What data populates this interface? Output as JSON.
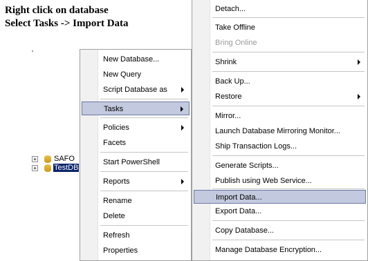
{
  "instructions": {
    "line1": "Right click on database",
    "line2": "Select Tasks -> Import Data"
  },
  "tree": {
    "nodes": [
      {
        "label": "SAFO",
        "selected": false
      },
      {
        "label": "TestDB",
        "selected": true
      }
    ]
  },
  "context_menu": {
    "items": [
      {
        "label": "New Database...",
        "submenu": false
      },
      {
        "label": "New Query",
        "submenu": false
      },
      {
        "label": "Script Database as",
        "submenu": true
      },
      {
        "label": "Tasks",
        "submenu": true,
        "highlighted": true
      },
      {
        "label": "Policies",
        "submenu": true
      },
      {
        "label": "Facets",
        "submenu": false
      },
      {
        "label": "Start PowerShell",
        "submenu": false
      },
      {
        "label": "Reports",
        "submenu": true
      },
      {
        "label": "Rename",
        "submenu": false
      },
      {
        "label": "Delete",
        "submenu": false
      },
      {
        "label": "Refresh",
        "submenu": false
      },
      {
        "label": "Properties",
        "submenu": false
      }
    ]
  },
  "tasks_menu": {
    "items": [
      {
        "label": "Detach..."
      },
      {
        "label": "Take Offline"
      },
      {
        "label": "Bring Online",
        "disabled": true
      },
      {
        "label": "Shrink",
        "submenu": true
      },
      {
        "label": "Back Up..."
      },
      {
        "label": "Restore",
        "submenu": true
      },
      {
        "label": "Mirror..."
      },
      {
        "label": "Launch Database Mirroring Monitor..."
      },
      {
        "label": "Ship Transaction Logs..."
      },
      {
        "label": "Generate Scripts..."
      },
      {
        "label": "Publish using Web Service..."
      },
      {
        "label": "Import Data...",
        "highlighted": true
      },
      {
        "label": "Export Data..."
      },
      {
        "label": "Copy Database..."
      },
      {
        "label": "Manage Database Encryption..."
      }
    ]
  }
}
